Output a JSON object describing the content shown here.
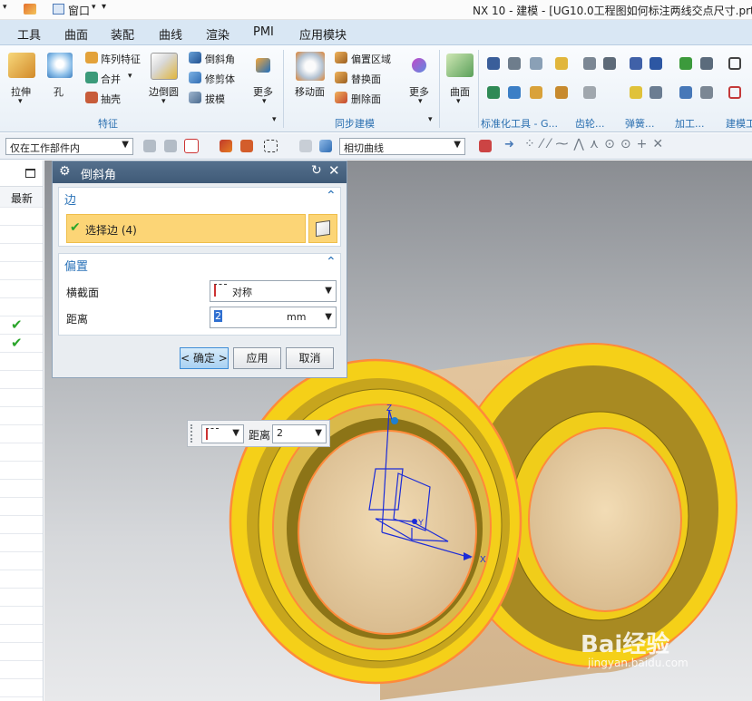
{
  "titlebar": {
    "quick_window": "窗口",
    "title": "NX 10 - 建模 - [UG10.0工程图如何标注两线交点尺寸.prt"
  },
  "menus": [
    "工具",
    "曲面",
    "装配",
    "曲线",
    "渲染",
    "PMI",
    "应用模块"
  ],
  "ribbon": {
    "features": {
      "extrude": "拉伸",
      "hole": "孔",
      "pattern_feature": "阵列特征",
      "unite": "合并",
      "shell": "抽壳",
      "edge_blend": "边倒圆",
      "chamfer": "倒斜角",
      "trim_body": "修剪体",
      "draft": "拔模",
      "more": "更多",
      "group": "特征"
    },
    "sync": {
      "move_face": "移动面",
      "offset_region": "偏置区域",
      "replace_face": "替换面",
      "delete_face": "删除面",
      "more": "更多",
      "group": "同步建模"
    },
    "surface": {
      "label": "曲面"
    },
    "groups": {
      "std_tools": "标准化工具 - G...",
      "gear": "齿轮...",
      "spring": "弹簧...",
      "machining": "加工...",
      "build_tools": "建模工"
    }
  },
  "toolbar2": {
    "selection_scope": "仅在工作部件内",
    "curve_rule": "相切曲线"
  },
  "part_nav": {
    "column_header": "最新"
  },
  "dialog": {
    "title": "倒斜角",
    "edge_section": {
      "title": "边",
      "select_edge": "选择边 (4)"
    },
    "offset_section": {
      "title": "偏置",
      "cross_section_label": "横截面",
      "cross_section_value": "对称",
      "distance_label": "距离",
      "distance_value": "2",
      "distance_unit": "mm"
    },
    "buttons": {
      "ok": "< 确定 >",
      "apply": "应用",
      "cancel": "取消"
    }
  },
  "minibar": {
    "distance_label": "距离",
    "distance_value": "2"
  },
  "viewport": {
    "axis_z": "Z",
    "axis_y": "Y",
    "axis_x": "X"
  },
  "watermark": {
    "brand": "Bai经验",
    "url": "jingyan.baidu.com"
  },
  "colors": {
    "accent": "#2b73b8",
    "selection_highlight": "#fcd576",
    "part_yellow": "#f5d018",
    "edge_orange": "#ff8a3a",
    "csys_blue": "#1c2cd8",
    "check_green": "#2aa52a"
  }
}
